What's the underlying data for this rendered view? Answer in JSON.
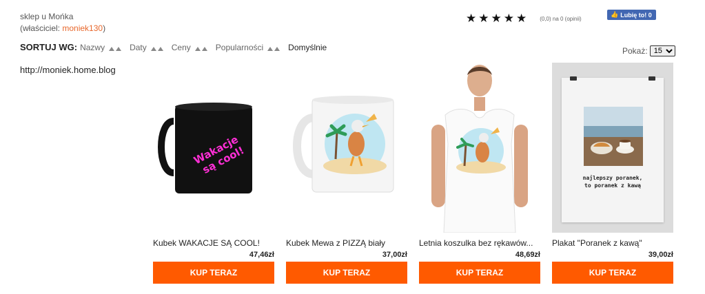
{
  "shop": {
    "title": "sklep u Mońka",
    "owner_prefix": "(właściciel: ",
    "owner_name": "moniek130",
    "owner_suffix": ")",
    "blog_url": "http://moniek.home.blog"
  },
  "rating": {
    "stars": "★★★★★",
    "value": 0,
    "max": 5,
    "text": "(0,0) na 0 (opinii)"
  },
  "facebook": {
    "like_label": "Lubię to! 0"
  },
  "sort": {
    "label": "SORTUJ WG:",
    "options": [
      "Nazwy",
      "Daty",
      "Ceny",
      "Popularności",
      "Domyślnie"
    ],
    "active": "Domyślnie"
  },
  "show": {
    "label": "Pokaż:",
    "selected": "15"
  },
  "products": [
    {
      "name": "Kubek WAKACJE SĄ COOL!",
      "price": "47,46zł",
      "button": "KUP TERAZ",
      "image_text": "Wakacje są cool!"
    },
    {
      "name": "Kubek Mewa z PIZZĄ biały",
      "price": "37,00zł",
      "button": "KUP TERAZ"
    },
    {
      "name": "Letnia koszulka bez rękawów...",
      "price": "48,69zł",
      "button": "KUP TERAZ"
    },
    {
      "name": "Plakat \"Poranek z kawą\"",
      "price": "39,00zł",
      "button": "KUP TERAZ",
      "image_text_line1": "najlepszy poranek,",
      "image_text_line2": "to poranek z kawą"
    }
  ],
  "colors": {
    "accent": "#ff5a00",
    "owner_link": "#e8672b",
    "facebook": "#4267b2",
    "mug_text": "#ff2fd6"
  }
}
